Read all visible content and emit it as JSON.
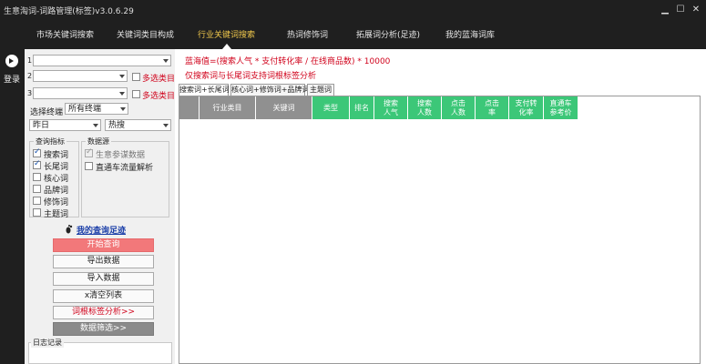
{
  "window": {
    "title": "生意淘词-词路管理(标签)v3.0.6.29",
    "controls": [
      "minimize",
      "maximize",
      "close"
    ]
  },
  "nav": {
    "tabs": [
      {
        "label": "市场关键词搜索"
      },
      {
        "label": "关键词类目构成"
      },
      {
        "label": "行业关键词搜索",
        "active": true
      },
      {
        "label": "热词修饰词"
      },
      {
        "label": "拓展词分析(足迹)"
      },
      {
        "label": "我的蓝海词库"
      }
    ]
  },
  "sidebar": {
    "login_label": "登录"
  },
  "filters": {
    "rows": [
      {
        "num": "1",
        "value": ""
      },
      {
        "num": "2",
        "value": "",
        "multi_label": "多选类目"
      },
      {
        "num": "3",
        "value": "",
        "multi_label": "多选类目"
      }
    ],
    "terminal_label": "选择终端",
    "terminal_value": "所有终端",
    "period_value": "昨日",
    "sort_value": "热搜",
    "metrics_group": {
      "title": "查询指标",
      "items": [
        {
          "label": "搜索词",
          "checked": true
        },
        {
          "label": "长尾词",
          "checked": true
        },
        {
          "label": "核心词",
          "checked": false
        },
        {
          "label": "品牌词",
          "checked": false
        },
        {
          "label": "修饰词",
          "checked": false
        },
        {
          "label": "主题词",
          "checked": false
        }
      ]
    },
    "source_group": {
      "title": "数据源",
      "items": [
        {
          "label": "生意参谋数据",
          "checked": true,
          "disabled": true
        },
        {
          "label": "直通车流量解析",
          "checked": false
        }
      ]
    },
    "history_link": "我的查询足迹"
  },
  "buttons": {
    "start": "开始查询",
    "export": "导出数据",
    "import": "导入数据",
    "clear": "x清空列表",
    "root_analysis": "词根标签分析>>",
    "data_filter": "数据筛选>>"
  },
  "log": {
    "title": "日志记录"
  },
  "main": {
    "formula": "蓝海值=(搜索人气 * 支付转化率 / 在线商品数) * 10000",
    "note": "仅搜索词与长尾词支持词根标签分析",
    "tabs": [
      {
        "label": "搜索词+长尾词",
        "active": true
      },
      {
        "label": "核心词+修饰词+品牌词"
      },
      {
        "label": "主题词"
      }
    ],
    "columns": [
      {
        "label": "行业类目",
        "style": "dark"
      },
      {
        "label": "关键词",
        "style": "dark"
      },
      {
        "label": "类型",
        "style": "green"
      },
      {
        "label": "排名",
        "style": "green"
      },
      {
        "label": "搜索\n人气",
        "style": "green"
      },
      {
        "label": "搜索\n人数",
        "style": "green"
      },
      {
        "label": "点击\n人数",
        "style": "green"
      },
      {
        "label": "点击\n率",
        "style": "green"
      },
      {
        "label": "支付转\n化率",
        "style": "green"
      },
      {
        "label": "直通车\n参考价",
        "style": "green"
      }
    ]
  },
  "colors": {
    "dark_bar": "#1f1f1f",
    "active_nav": "#f2c94c",
    "header_green": "#3cc778",
    "header_gray": "#909090",
    "accent_red": "#d0021b",
    "primary_button": "#f2787a"
  }
}
